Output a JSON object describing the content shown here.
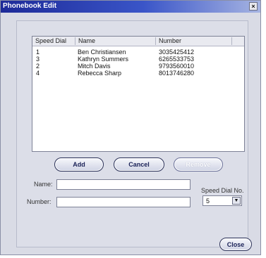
{
  "window": {
    "title": "Phonebook Edit",
    "close_glyph": "×"
  },
  "list": {
    "columns": [
      "Speed Dial",
      "Name",
      "Number"
    ],
    "rows": [
      {
        "speed_dial": "1",
        "name": "Ben Christiansen",
        "number": "3035425412"
      },
      {
        "speed_dial": "3",
        "name": "Kathryn Summers",
        "number": "6265533753"
      },
      {
        "speed_dial": "2",
        "name": "Mitch Davis",
        "number": "9793560010"
      },
      {
        "speed_dial": "4",
        "name": "Rebecca Sharp",
        "number": "8013746280"
      }
    ]
  },
  "buttons": {
    "add": "Add",
    "cancel": "Cancel",
    "remove": "Remove",
    "close": "Close"
  },
  "form": {
    "name_label": "Name:",
    "name_value": "",
    "number_label": "Number:",
    "number_value": "",
    "speed_dial_label": "Speed Dial No.",
    "speed_dial_value": "5"
  },
  "icons": {
    "dropdown": "chevron-down-icon",
    "close": "close-icon"
  }
}
